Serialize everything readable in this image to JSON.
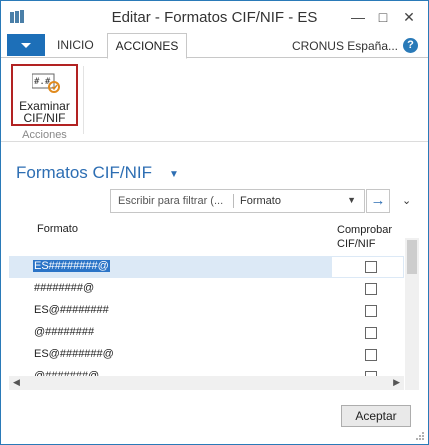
{
  "window": {
    "title": "Editar - Formatos CIF/NIF - ES"
  },
  "ribbon": {
    "tabs": [
      "INICIO",
      "ACCIONES"
    ],
    "company": "CRONUS España...",
    "buttons": [
      {
        "label_line1": "Examinar",
        "label_line2": "CIF/NIF"
      }
    ],
    "group": "Acciones"
  },
  "page": {
    "title": "Formatos CIF/NIF"
  },
  "filter": {
    "placeholder": "Escribir para filtrar (...",
    "field": "Formato"
  },
  "grid": {
    "columns": {
      "format": "Formato",
      "check_line1": "Comprobar",
      "check_line2": "CIF/NIF"
    },
    "rows": [
      {
        "format": "ES########@",
        "checked": false
      },
      {
        "format": "########@",
        "checked": false
      },
      {
        "format": "ES@########",
        "checked": false
      },
      {
        "format": "@########",
        "checked": false
      },
      {
        "format": "ES@#######@",
        "checked": false
      },
      {
        "format": "@#######@",
        "checked": false
      }
    ]
  },
  "footer": {
    "ok_label": "Aceptar"
  },
  "colors": {
    "accent": "#2d6eb3",
    "selection": "#2b74c7",
    "highlight_border": "#b22222"
  }
}
